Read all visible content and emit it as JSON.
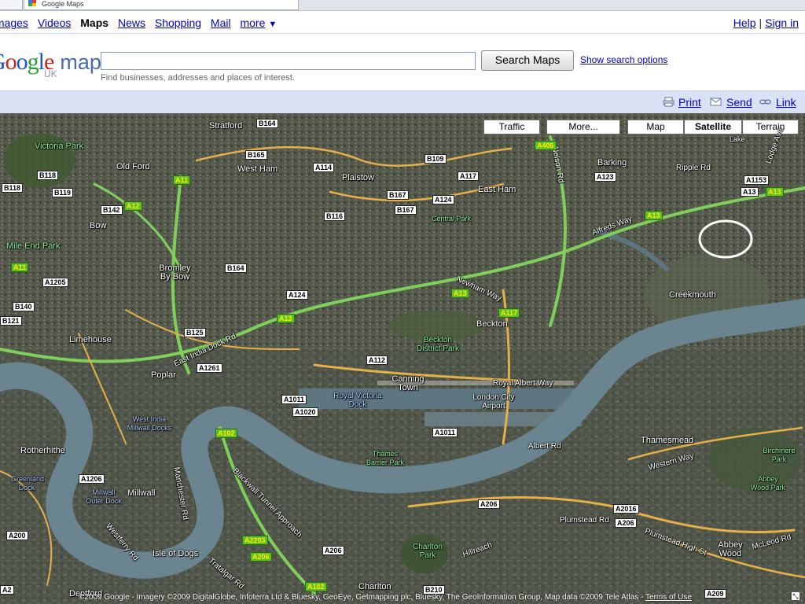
{
  "browser": {
    "tab_title": "Google Maps"
  },
  "nav": {
    "left_links": [
      "Images",
      "Videos"
    ],
    "current": "Maps",
    "right_of_current": [
      "News",
      "Shopping",
      "Mail"
    ],
    "more_label": "more",
    "more_arrow": "▼",
    "help_label": "Help",
    "signin_label": "Sign in"
  },
  "header": {
    "logo_letters": [
      "G",
      "o",
      "o",
      "g",
      "l",
      "e"
    ],
    "logo_maps": "maps",
    "logo_region": "UK",
    "search_value": "",
    "search_placeholder": "",
    "search_button": "Search Maps",
    "search_options": "Show search options",
    "hint": "Find businesses, addresses and places of interest."
  },
  "toolbar": {
    "print": "Print",
    "send": "Send",
    "link": "Link"
  },
  "map_controls": {
    "traffic": "Traffic",
    "more": "More...",
    "map": "Map",
    "satellite": "Satellite",
    "terrain": "Terrain",
    "active_type": "Satellite"
  },
  "places": [
    {
      "text": "Stratford"
    },
    {
      "text": "West Ham"
    },
    {
      "text": "Plaistow"
    },
    {
      "text": "Old Ford"
    },
    {
      "text": "Victoria Park"
    },
    {
      "text": "Bow"
    },
    {
      "text": "Mile End Park"
    },
    {
      "text": "Bromley By Bow"
    },
    {
      "text": "Limehouse"
    },
    {
      "text": "Poplar"
    },
    {
      "text": "East Ham"
    },
    {
      "text": "Central Park"
    },
    {
      "text": "Barking"
    },
    {
      "text": "Beckton"
    },
    {
      "text": "Beckton District Park"
    },
    {
      "text": "Creekmouth"
    },
    {
      "text": "Canning Town"
    },
    {
      "text": "Royal Victoria Dock"
    },
    {
      "text": "London City Airport"
    },
    {
      "text": "Royal Albert Way"
    },
    {
      "text": "Thamesmead"
    },
    {
      "text": "Birchmere Park"
    },
    {
      "text": "Abbey Wood Park"
    },
    {
      "text": "Abbey Wood"
    },
    {
      "text": "Rotherhithe"
    },
    {
      "text": "Greenland Dock"
    },
    {
      "text": "Millwall"
    },
    {
      "text": "Millwall Outer Dock"
    },
    {
      "text": "West India Millwall Docks"
    },
    {
      "text": "Isle of Dogs"
    },
    {
      "text": "Thames Barrier Park"
    },
    {
      "text": "Charlton Park"
    },
    {
      "text": "Charlton"
    },
    {
      "text": "Lake"
    },
    {
      "text": "Newham Way"
    },
    {
      "text": "Alfreds Way"
    },
    {
      "text": "Nelson Rd"
    },
    {
      "text": "Albert Rd"
    },
    {
      "text": "Plumstead Rd"
    },
    {
      "text": "Plumstead High St"
    },
    {
      "text": "Western Way"
    },
    {
      "text": "McLeod Rd"
    },
    {
      "text": "Hillreach"
    },
    {
      "text": "Tratalgar Rd"
    },
    {
      "text": "Deptford"
    },
    {
      "text": "Westferry Rd"
    },
    {
      "text": "Blackwall Tunnel Approach"
    },
    {
      "text": "East India Dock Rd"
    },
    {
      "text": "Manchester Rd"
    },
    {
      "text": "Ripple Rd"
    },
    {
      "text": "Lodge Ave"
    }
  ],
  "road_shields": [
    {
      "text": "B164",
      "kind": "w"
    },
    {
      "text": "B165",
      "kind": "w"
    },
    {
      "text": "A114",
      "kind": "w"
    },
    {
      "text": "B109",
      "kind": "w"
    },
    {
      "text": "A117",
      "kind": "w"
    },
    {
      "text": "A406",
      "kind": "g"
    },
    {
      "text": "A123",
      "kind": "w"
    },
    {
      "text": "A1153",
      "kind": "w"
    },
    {
      "text": "A13",
      "kind": "w"
    },
    {
      "text": "A13",
      "kind": "g"
    },
    {
      "text": "B118",
      "kind": "w"
    },
    {
      "text": "B118",
      "kind": "w"
    },
    {
      "text": "B119",
      "kind": "w"
    },
    {
      "text": "A11",
      "kind": "g"
    },
    {
      "text": "B142",
      "kind": "w"
    },
    {
      "text": "A12",
      "kind": "g"
    },
    {
      "text": "B167",
      "kind": "w"
    },
    {
      "text": "A124",
      "kind": "w"
    },
    {
      "text": "B167",
      "kind": "w"
    },
    {
      "text": "B116",
      "kind": "w"
    },
    {
      "text": "A13",
      "kind": "g"
    },
    {
      "text": "A11",
      "kind": "g"
    },
    {
      "text": "A1205",
      "kind": "w"
    },
    {
      "text": "B164",
      "kind": "w"
    },
    {
      "text": "A124",
      "kind": "w"
    },
    {
      "text": "A13",
      "kind": "g"
    },
    {
      "text": "A117",
      "kind": "g"
    },
    {
      "text": "B140",
      "kind": "w"
    },
    {
      "text": "B121",
      "kind": "w"
    },
    {
      "text": "B125",
      "kind": "w"
    },
    {
      "text": "A13",
      "kind": "g"
    },
    {
      "text": "A1261",
      "kind": "w"
    },
    {
      "text": "A112",
      "kind": "w"
    },
    {
      "text": "A1011",
      "kind": "w"
    },
    {
      "text": "A1020",
      "kind": "w"
    },
    {
      "text": "A1011",
      "kind": "w"
    },
    {
      "text": "A102",
      "kind": "g"
    },
    {
      "text": "A1206",
      "kind": "w"
    },
    {
      "text": "A206",
      "kind": "w"
    },
    {
      "text": "A2016",
      "kind": "w"
    },
    {
      "text": "A206",
      "kind": "w"
    },
    {
      "text": "A200",
      "kind": "w"
    },
    {
      "text": "A2203",
      "kind": "g"
    },
    {
      "text": "A206",
      "kind": "g"
    },
    {
      "text": "A206",
      "kind": "w"
    },
    {
      "text": "A102",
      "kind": "g"
    },
    {
      "text": "B210",
      "kind": "w"
    },
    {
      "text": "A209",
      "kind": "w"
    },
    {
      "text": "A2",
      "kind": "w"
    }
  ],
  "copyright": "©2009 Google - Imagery ©2009 DigitalGlobe, Infoterra Ltd & Bluesky, GeoEye, Getmapping plc, Bluesky, The GeoInformation Group, Map data ©2009 Tele Atlas -",
  "terms": "Terms of Use",
  "colors": {
    "link": "#0000cc",
    "toolbar_bg": "#d9e2f4",
    "river": "#6b8590",
    "major_road": "#7fd05a"
  }
}
